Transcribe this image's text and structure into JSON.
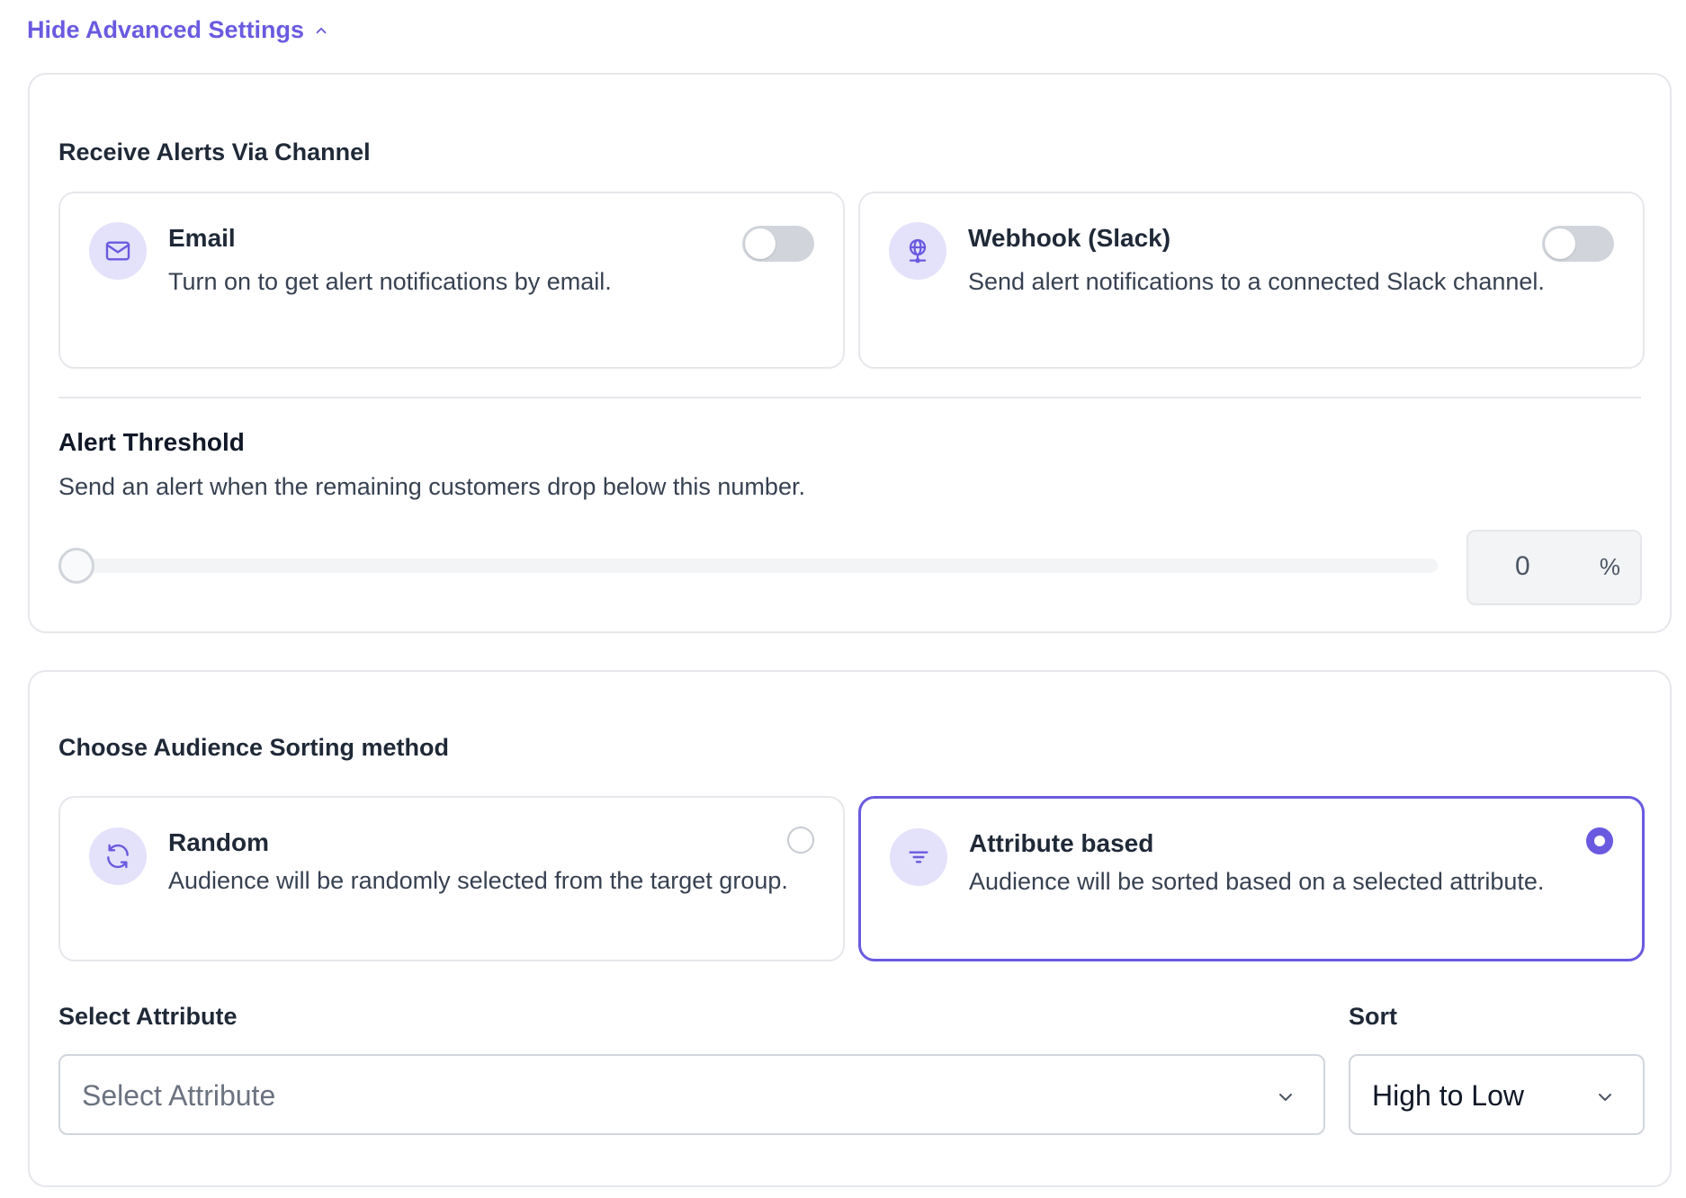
{
  "header": {
    "toggle_label": "Hide Advanced Settings"
  },
  "alerts": {
    "section_title": "Receive Alerts Via Channel",
    "channels": [
      {
        "title": "Email",
        "description": "Turn on to get alert notifications by email.",
        "icon": "envelope-icon",
        "enabled": false
      },
      {
        "title": "Webhook (Slack)",
        "description": "Send alert notifications to a connected Slack channel.",
        "icon": "globe-icon",
        "enabled": false
      }
    ],
    "threshold": {
      "title": "Alert Threshold",
      "description": "Send an alert when the remaining customers drop below this number.",
      "value": "0",
      "unit": "%"
    }
  },
  "sorting": {
    "section_title": "Choose Audience Sorting method",
    "options": [
      {
        "title": "Random",
        "description": "Audience will be randomly selected from the target group.",
        "icon": "refresh-icon",
        "selected": false
      },
      {
        "title": "Attribute based",
        "description": "Audience will be sorted based on a selected attribute.",
        "icon": "filter-icon",
        "selected": true
      }
    ],
    "attribute": {
      "label": "Select Attribute",
      "placeholder": "Select Attribute"
    },
    "sort": {
      "label": "Sort",
      "value": "High to Low"
    }
  },
  "colors": {
    "accent": "#6a5ae0",
    "icon_bg": "#e4e1fa",
    "border": "#e5e7eb",
    "toggle_off": "#d1d5db"
  }
}
